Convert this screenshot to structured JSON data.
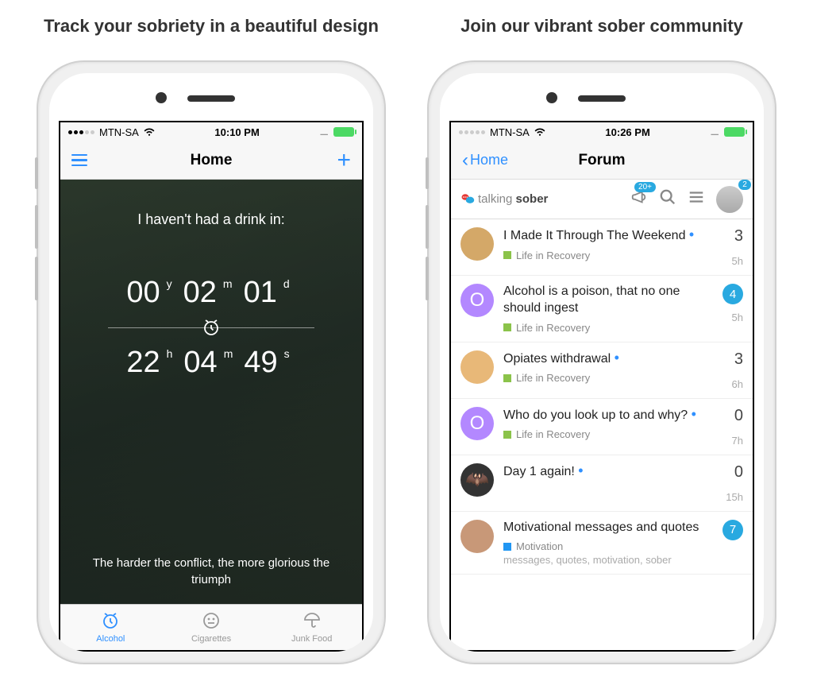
{
  "panels": {
    "left_caption": "Track your sobriety in a beautiful design",
    "right_caption": "Join our vibrant sober community"
  },
  "screen1": {
    "status": {
      "carrier": "MTN-SA",
      "time": "10:10 PM"
    },
    "nav": {
      "title": "Home"
    },
    "tracker": {
      "heading": "I haven't had a drink in:",
      "years": "00",
      "months": "02",
      "days": "01",
      "y_label": "y",
      "m_label": "m",
      "d_label": "d",
      "hours": "22",
      "minutes": "04",
      "seconds": "49",
      "h_label": "h",
      "min_label": "m",
      "s_label": "s",
      "quote": "The harder the conflict, the more glorious the triumph"
    },
    "tabs": {
      "alcohol": "Alcohol",
      "cigarettes": "Cigarettes",
      "junkfood": "Junk Food"
    }
  },
  "screen2": {
    "status": {
      "carrier": "MTN-SA",
      "time": "10:26 PM"
    },
    "nav": {
      "back": "Home",
      "title": "Forum"
    },
    "header": {
      "logo_light": "talking ",
      "logo_bold": "sober",
      "announce_badge": "20+",
      "avatar_badge": "2"
    },
    "threads": [
      {
        "title": "I Made It Through The Weekend",
        "dot": true,
        "category": "Life in Recovery",
        "cat_color": "#8bc34a",
        "count": "3",
        "count_badge": false,
        "time": "5h",
        "avatar_bg": "#d4a868",
        "avatar_letter": ""
      },
      {
        "title": "Alcohol is a poison, that no one should ingest",
        "dot": false,
        "category": "Life in Recovery",
        "cat_color": "#8bc34a",
        "count": "4",
        "count_badge": true,
        "time": "5h",
        "avatar_bg": "#b388ff",
        "avatar_letter": "O"
      },
      {
        "title": "Opiates withdrawal",
        "dot": true,
        "category": "Life in Recovery",
        "cat_color": "#8bc34a",
        "count": "3",
        "count_badge": false,
        "time": "6h",
        "avatar_bg": "#e8b878",
        "avatar_letter": ""
      },
      {
        "title": "Who do you look up to and why?",
        "dot": true,
        "category": "Life in Recovery",
        "cat_color": "#8bc34a",
        "count": "0",
        "count_badge": false,
        "time": "7h",
        "avatar_bg": "#b388ff",
        "avatar_letter": "O"
      },
      {
        "title": "Day 1 again!",
        "dot": true,
        "category": "",
        "cat_color": "",
        "count": "0",
        "count_badge": false,
        "time": "15h",
        "avatar_bg": "#333",
        "avatar_letter": "🦇"
      },
      {
        "title": "Motivational messages and quotes",
        "dot": false,
        "category": "Motivation",
        "cat_color": "#2196f3",
        "count": "7",
        "count_badge": true,
        "time": "",
        "avatar_bg": "#c89878",
        "avatar_letter": "",
        "tags": "messages, quotes, motivation, sober"
      }
    ]
  }
}
